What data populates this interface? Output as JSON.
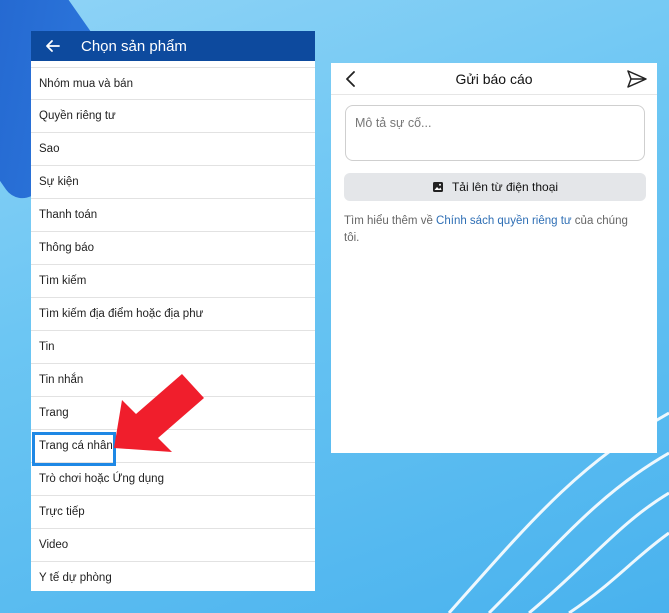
{
  "left_panel": {
    "title": "Chọn sản phẩm",
    "back_icon": "arrow-left-icon",
    "items": [
      "Nhóm mua và bán",
      "Quyền riêng tư",
      "Sao",
      "Sự kiện",
      "Thanh toán",
      "Thông báo",
      "Tìm kiếm",
      "Tìm kiếm địa điểm hoặc địa phư",
      "Tin",
      "Tin nhắn",
      "Trang",
      "Trang cá nhân",
      "Trò chơi hoặc Ứng dụng",
      "Trực tiếp",
      "Video",
      "Y tế dự phòng"
    ],
    "highlighted_item": "Trang cá nhân",
    "highlight_color": "#1e88e5",
    "arrow_color": "#f01e2c"
  },
  "right_panel": {
    "title": "Gửi báo cáo",
    "back_icon": "chevron-left-icon",
    "send_icon": "send-icon",
    "description_placeholder": "Mô tả sự cố...",
    "upload_label": "Tải lên từ điện thoại",
    "upload_icon": "image-icon",
    "info_prefix": "Tìm hiểu thêm về ",
    "info_link": "Chính sách quyền riêng tư",
    "info_suffix": " của chúng tôi."
  },
  "colors": {
    "header_blue": "#0d4a9e",
    "link_blue": "#2f6fb5"
  }
}
